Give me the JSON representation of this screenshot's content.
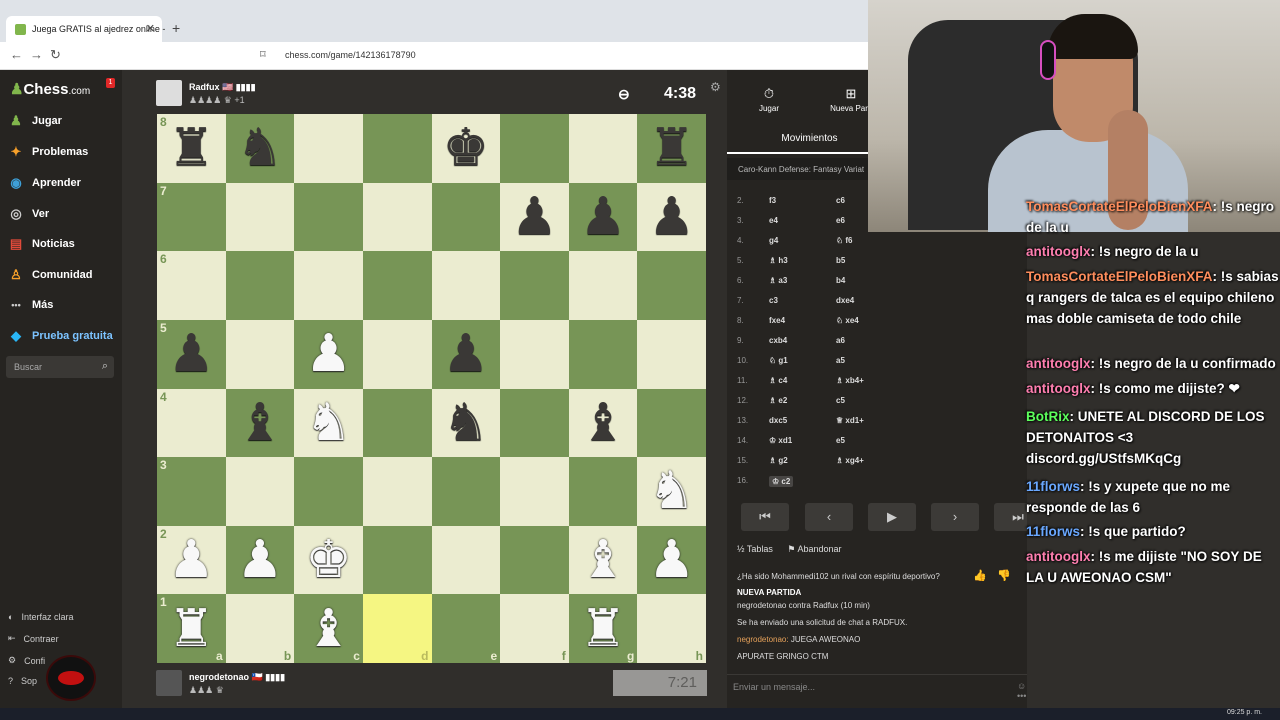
{
  "browser": {
    "tab_title": "Juega GRATIS al ajedrez online -",
    "tab_close": "✕",
    "new_tab": "+",
    "url": "chess.com/game/142136178790"
  },
  "sidebar": {
    "logo": "Chess",
    "logo_suffix": ".com",
    "notification_count": "1",
    "items": [
      {
        "label": "Jugar",
        "icon": "♟"
      },
      {
        "label": "Problemas",
        "icon": "✦"
      },
      {
        "label": "Aprender",
        "icon": "◉"
      },
      {
        "label": "Ver",
        "icon": "◎"
      },
      {
        "label": "Noticias",
        "icon": "▤"
      },
      {
        "label": "Comunidad",
        "icon": "♙"
      },
      {
        "label": "Más",
        "icon": "•••"
      },
      {
        "label": "Prueba gratuita",
        "icon": "◆"
      }
    ],
    "search_placeholder": "Buscar",
    "footer": [
      {
        "label": "Interfaz clara",
        "icon": "◐"
      },
      {
        "label": "Contraer",
        "icon": "⇤"
      },
      {
        "label": "Confi",
        "icon": "⚙"
      },
      {
        "label": "Sop",
        "icon": "?"
      }
    ]
  },
  "game": {
    "top_player": {
      "name": "Radfux 🇺🇸 ▮▮▮▮",
      "captured": "♟♟♟♟ ♛ +1"
    },
    "top_clock": "4:38",
    "bottom_player": {
      "name": "negrodetonao 🇨🇱 ▮▮▮▮",
      "captured": "♟♟♟ ♛"
    },
    "bottom_clock": "7:21",
    "ranks": [
      "8",
      "7",
      "6",
      "5",
      "4",
      "3",
      "2",
      "1"
    ],
    "files": [
      "a",
      "b",
      "c",
      "d",
      "e",
      "f",
      "g",
      "h"
    ],
    "board": [
      [
        "br",
        "bn",
        "",
        "",
        "bk",
        "",
        "",
        "br"
      ],
      [
        "",
        "",
        "",
        "",
        "",
        "bp",
        "bp",
        "bp"
      ],
      [
        "",
        "",
        "",
        "",
        "",
        "",
        "",
        ""
      ],
      [
        "bp",
        "",
        "wp",
        "",
        "bp",
        "",
        "",
        ""
      ],
      [
        "",
        "bb",
        "wn",
        "",
        "bn",
        "",
        "bb",
        ""
      ],
      [
        "",
        "",
        "",
        "",
        "",
        "",
        "",
        "wn"
      ],
      [
        "wp",
        "wp",
        "wk",
        "",
        "",
        "",
        "wb",
        "wp"
      ],
      [
        "wr",
        "",
        "wb",
        "",
        "",
        "",
        "wr",
        ""
      ]
    ],
    "highlight": "d1"
  },
  "panel": {
    "tabs": [
      {
        "label": "Jugar",
        "icon": "⏱"
      },
      {
        "label": "Nueva Parti",
        "icon": "⊞"
      }
    ],
    "moves_title": "Movimientos",
    "opening": "Caro-Kann Defense: Fantasy Variat",
    "moves": [
      {
        "n": "2.",
        "w": "f3",
        "b": "c6"
      },
      {
        "n": "3.",
        "w": "e4",
        "b": "e6"
      },
      {
        "n": "4.",
        "w": "g4",
        "b": "♘ f6"
      },
      {
        "n": "5.",
        "w": "♗ h3",
        "b": "b5"
      },
      {
        "n": "6.",
        "w": "♗ a3",
        "b": "b4"
      },
      {
        "n": "7.",
        "w": "c3",
        "b": "dxe4"
      },
      {
        "n": "8.",
        "w": "fxe4",
        "b": "♘ xe4"
      },
      {
        "n": "9.",
        "w": "cxb4",
        "b": "a6"
      },
      {
        "n": "10.",
        "w": "♘ g1",
        "b": "a5"
      },
      {
        "n": "11.",
        "w": "♗ c4",
        "b": "♗ xb4+"
      },
      {
        "n": "12.",
        "w": "♗ e2",
        "b": "c5"
      },
      {
        "n": "13.",
        "w": "dxc5",
        "b": "♕ xd1+"
      },
      {
        "n": "14.",
        "w": "♔ xd1",
        "b": "e5"
      },
      {
        "n": "15.",
        "w": "♗ g2",
        "b": "♗ xg4+"
      },
      {
        "n": "16.",
        "w": "♔ c2",
        "b": ""
      }
    ],
    "controls": [
      "⏮",
      "‹",
      "▶",
      "›",
      "⏭"
    ],
    "draw_label": "½ Tablas",
    "resign_label": "⚑ Abandonar",
    "sportsman_q": "¿Ha sido Mohammedi102 un rival con espíritu deportivo?",
    "new_game": "NUEVA PARTIDA",
    "match": "negrodetonao contra Radfux (10 min)",
    "chat_request": "Se ha enviado una solicitud de chat a RADFUX.",
    "chat_user": "negrodetonao:",
    "chat_msg1": "JUEGA AWEONAO",
    "chat_msg2": "APURATE GRINGO CTM",
    "chat_placeholder": "Enviar un mensaje...",
    "chat_emoji": "☺ •••"
  },
  "twitch_chat": [
    {
      "user": "TomasCortateElPeloBienXFA",
      "text": ": !s negro de la u",
      "cls": "u1"
    },
    {
      "user": "antitooglx",
      "text": ": !s negro de la u",
      "cls": "u2"
    },
    {
      "user": "TomasCortateElPeloBienXFA",
      "text": ": !s sabias q rangers de talca es el equipo chileno mas doble camiseta de todo chile",
      "cls": "u1"
    },
    {
      "user": "antitooglx",
      "text": ": !s negro de la u confirmado",
      "cls": "u2"
    },
    {
      "user": "antitooglx",
      "text": ": !s como me dijiste? ❤",
      "cls": "u2"
    },
    {
      "user": "BotRix",
      "text": ": UNETE AL DISCORD DE LOS DETONAITOS <3 discord.gg/UStfsMKqCg",
      "cls": "u3"
    },
    {
      "user": "11florws",
      "text": ": !s y xupete que no me responde de las 6",
      "cls": "u4"
    },
    {
      "user": "11florws",
      "text": ": !s que partido?",
      "cls": "u4"
    },
    {
      "user": "antitooglx",
      "text": ": !s me dijiste \"NO SOY DE LA U AWEONAO CSM\"",
      "cls": "u2"
    }
  ],
  "taskbar_time": "09:25 p. m."
}
